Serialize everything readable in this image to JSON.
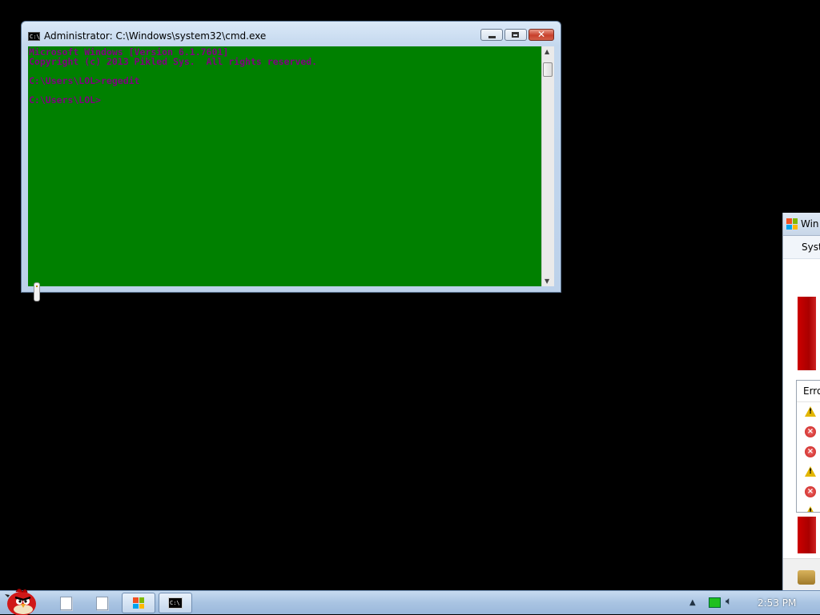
{
  "cmd_window": {
    "title": "Administrator: C:\\Windows\\system32\\cmd.exe",
    "icon_label": "C:\\",
    "controls": {
      "minimize": "minimize",
      "maximize": "maximize",
      "close": "✕"
    },
    "console_lines": [
      "Microsoft Windows [Version 6.1.7601]",
      "Copyright (c) 2013 Pikled Sys.  All rights reserved.",
      "",
      "C:\\Users\\LOL>regedit",
      "",
      "C:\\Users\\LOL>"
    ],
    "colors": {
      "background": "#008000",
      "text": "#800080"
    }
  },
  "side_window": {
    "title": "Win",
    "menu_item": "Syst",
    "list_header": "Erro",
    "rows": [
      "warning",
      "error",
      "error",
      "warning",
      "error",
      "warning"
    ]
  },
  "taskbar": {
    "clock": "2:53 PM",
    "items": [
      "angry-bird-start",
      "document",
      "document",
      "windows-explorer",
      "command-prompt"
    ]
  }
}
